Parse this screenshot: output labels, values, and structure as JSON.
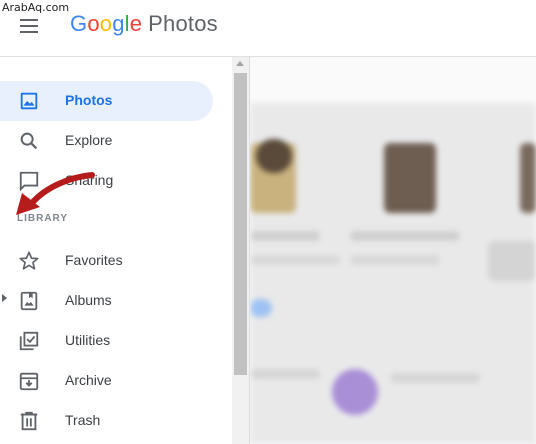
{
  "watermark": "ArabAq.com",
  "header": {
    "logo_letters": [
      {
        "ch": "G",
        "color": "#4285f4"
      },
      {
        "ch": "o",
        "color": "#ea4335"
      },
      {
        "ch": "o",
        "color": "#fbbc05"
      },
      {
        "ch": "g",
        "color": "#4285f4"
      },
      {
        "ch": "l",
        "color": "#34a853"
      },
      {
        "ch": "e",
        "color": "#ea4335"
      }
    ],
    "product": "Photos",
    "menu_icon": "hamburger-menu-icon"
  },
  "sidebar": {
    "items": [
      {
        "label": "Photos",
        "icon": "photo-icon",
        "active": true
      },
      {
        "label": "Explore",
        "icon": "search-icon",
        "active": false
      },
      {
        "label": "Sharing",
        "icon": "chat-bubble-icon",
        "active": false
      },
      {
        "label": "Favorites",
        "icon": "star-icon",
        "active": false
      },
      {
        "label": "Albums",
        "icon": "album-icon",
        "active": false
      },
      {
        "label": "Utilities",
        "icon": "checklist-icon",
        "active": false
      },
      {
        "label": "Archive",
        "icon": "archive-icon",
        "active": false
      },
      {
        "label": "Trash",
        "icon": "trash-icon",
        "active": false
      }
    ],
    "library_label": "LIBRARY"
  },
  "colors": {
    "accent": "#1a73e8",
    "active_bg": "#e8f0fe",
    "annotation_arrow": "#b71c1c"
  }
}
